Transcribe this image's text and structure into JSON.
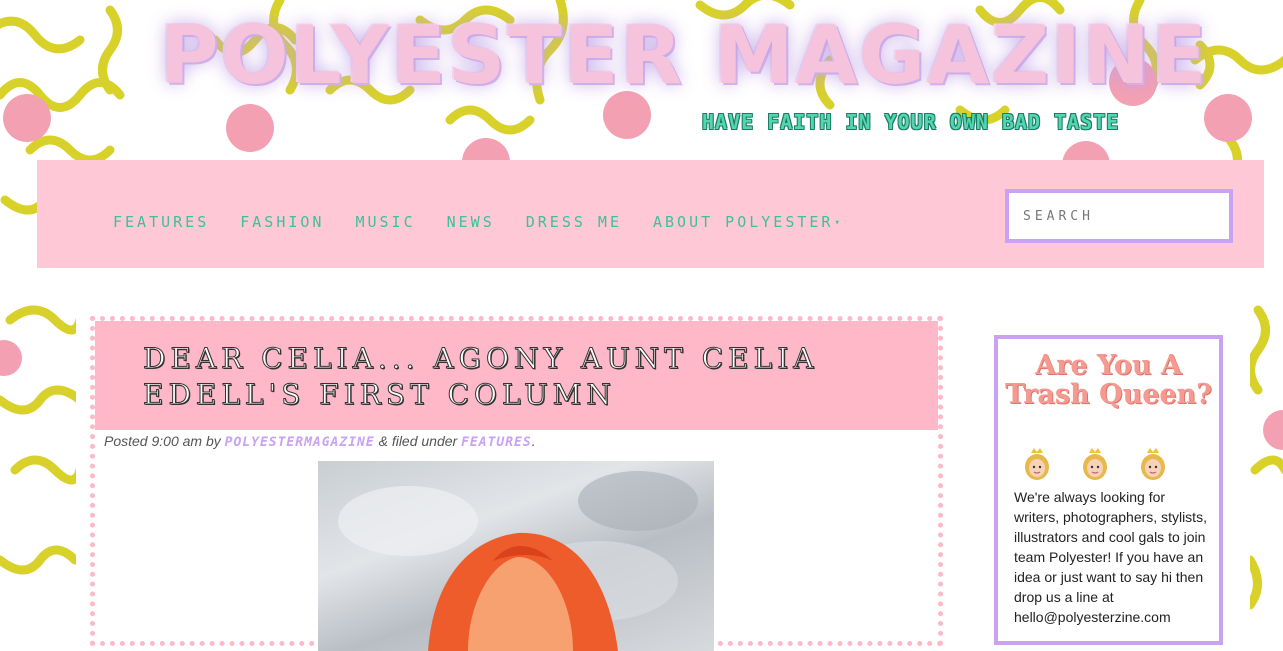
{
  "header": {
    "logo_title": "POLYESTER MAGAZINE",
    "tagline": "HAVE FAITH IN YOUR OWN BAD TASTE"
  },
  "nav": {
    "items": [
      "FEATURES",
      "FASHION",
      "MUSIC",
      "NEWS",
      "DRESS ME",
      "ABOUT POLYESTER"
    ],
    "dropdown_caret": "▾",
    "search_placeholder": "SEARCH"
  },
  "post": {
    "title": "DEAR CELIA... AGONY AUNT CELIA EDELL'S FIRST COLUMN",
    "meta_prefix": "Posted 9:00 am by ",
    "author": "POLYESTERMAGAZINE",
    "meta_middle": " & filed under ",
    "category": "FEATURES",
    "meta_suffix": ".",
    "image_icon": "portrait-photo"
  },
  "sidebar": {
    "widget_title": "Are You A Trash Queen?",
    "emoji_icons": [
      "princess-icon",
      "princess-icon",
      "princess-icon"
    ],
    "body": "We're always looking for writers, photographers, stylists, illustrators and cool gals to join team Polyester! If you have an idea or just want to say hi then drop us a line at hello@polyesterzine.com"
  },
  "colors": {
    "nav_bg": "#ffc8d6",
    "nav_text": "#3fbf9a",
    "accent_lilac": "#c9a2f2",
    "post_border": "#ffb8c8",
    "squiggle": "#d8d12a",
    "dot": "#f4a0b3",
    "widget_title": "#f59a90"
  }
}
